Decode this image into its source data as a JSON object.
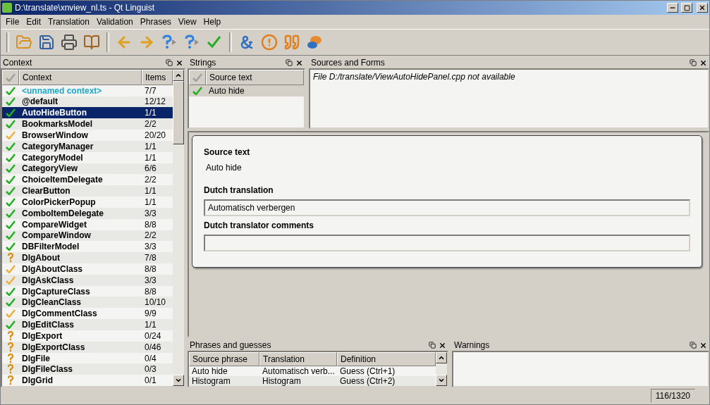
{
  "window": {
    "title": "D:\\translate\\xnview_nl.ts - Qt Linguist"
  },
  "menu": [
    "File",
    "Edit",
    "Translation",
    "Validation",
    "Phrases",
    "View",
    "Help"
  ],
  "context_dock": {
    "title": "Context",
    "columns": [
      "Context",
      "Items"
    ],
    "rows": [
      {
        "name": "<unnamed context>",
        "items": "7/7",
        "kind": "done",
        "selected": false,
        "unnamed": true
      },
      {
        "name": "@default",
        "items": "12/12",
        "kind": "done",
        "selected": false
      },
      {
        "name": "AutoHideButton",
        "items": "1/1",
        "kind": "done",
        "selected": true
      },
      {
        "name": "BookmarksModel",
        "items": "2/2",
        "kind": "done",
        "selected": false
      },
      {
        "name": "BrowserWindow",
        "items": "20/20",
        "kind": "warn",
        "selected": false
      },
      {
        "name": "CategoryManager",
        "items": "1/1",
        "kind": "done",
        "selected": false
      },
      {
        "name": "CategoryModel",
        "items": "1/1",
        "kind": "done",
        "selected": false
      },
      {
        "name": "CategoryView",
        "items": "6/6",
        "kind": "done",
        "selected": false
      },
      {
        "name": "ChoiceItemDelegate",
        "items": "2/2",
        "kind": "done",
        "selected": false
      },
      {
        "name": "ClearButton",
        "items": "1/1",
        "kind": "done",
        "selected": false
      },
      {
        "name": "ColorPickerPopup",
        "items": "1/1",
        "kind": "done",
        "selected": false
      },
      {
        "name": "ComboItemDelegate",
        "items": "3/3",
        "kind": "done",
        "selected": false
      },
      {
        "name": "CompareWidget",
        "items": "8/8",
        "kind": "done",
        "selected": false
      },
      {
        "name": "CompareWindow",
        "items": "2/2",
        "kind": "done",
        "selected": false
      },
      {
        "name": "DBFilterModel",
        "items": "3/3",
        "kind": "done",
        "selected": false
      },
      {
        "name": "DlgAbout",
        "items": "7/8",
        "kind": "todo",
        "selected": false
      },
      {
        "name": "DlgAboutClass",
        "items": "8/8",
        "kind": "warn",
        "selected": false
      },
      {
        "name": "DlgAskClass",
        "items": "3/3",
        "kind": "warn",
        "selected": false
      },
      {
        "name": "DlgCaptureClass",
        "items": "8/8",
        "kind": "done",
        "selected": false
      },
      {
        "name": "DlgCleanClass",
        "items": "10/10",
        "kind": "done",
        "selected": false
      },
      {
        "name": "DlgCommentClass",
        "items": "9/9",
        "kind": "warn",
        "selected": false
      },
      {
        "name": "DlgEditClass",
        "items": "1/1",
        "kind": "done",
        "selected": false
      },
      {
        "name": "DlgExport",
        "items": "0/24",
        "kind": "todo",
        "selected": false
      },
      {
        "name": "DlgExportClass",
        "items": "0/46",
        "kind": "todo",
        "selected": false
      },
      {
        "name": "DlgFile",
        "items": "0/4",
        "kind": "todo",
        "selected": false
      },
      {
        "name": "DlgFileClass",
        "items": "0/3",
        "kind": "todo",
        "selected": false
      },
      {
        "name": "DlgGrid",
        "items": "0/1",
        "kind": "todo",
        "selected": false
      }
    ]
  },
  "strings_dock": {
    "title": "Strings",
    "columns": [
      "Source text"
    ],
    "rows": [
      {
        "text": "Auto hide",
        "kind": "done",
        "selected": true
      }
    ]
  },
  "sources_dock": {
    "title": "Sources and Forms",
    "message": "File D:/translate/ViewAutoHidePanel.cpp not available"
  },
  "editor": {
    "source_label": "Source text",
    "source": "Auto hide",
    "translation_label": "Dutch translation",
    "translation": "Automatisch verbergen",
    "comments_label": "Dutch translator comments"
  },
  "phrases_dock": {
    "title": "Phrases and guesses",
    "columns": [
      "Source phrase",
      "Translation",
      "Definition"
    ],
    "rows": [
      [
        "Auto hide",
        "Automatisch verb...",
        "Guess (Ctrl+1)"
      ],
      [
        "Histogram",
        "Histogram",
        "Guess (Ctrl+2)"
      ]
    ]
  },
  "warnings_dock": {
    "title": "Warnings"
  },
  "status_bar": {
    "count": "116/1320"
  }
}
